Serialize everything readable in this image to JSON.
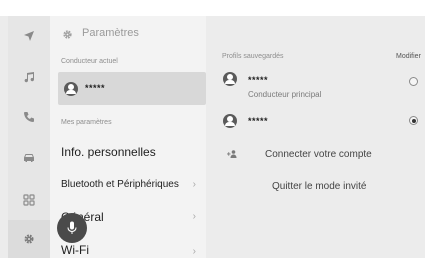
{
  "settings": {
    "title": "Paramètres",
    "current_driver_label": "Conducteur actuel",
    "current_driver_name": "*****",
    "my_settings_label": "Mes paramètres",
    "menu": [
      {
        "label": "Info. personnelles",
        "has_chevron": false
      },
      {
        "label": "Bluetooth et Périphériques",
        "has_chevron": true
      },
      {
        "label": "Général",
        "has_chevron": true
      },
      {
        "label": "Wi-Fi",
        "has_chevron": true
      }
    ]
  },
  "rail": {
    "icons": [
      "navigation-icon",
      "music-icon",
      "phone-icon",
      "car-icon",
      "apps-icon",
      "settings-gear-icon"
    ],
    "active": "settings-gear-icon"
  },
  "profiles": {
    "saved_label": "Profils sauvegardés",
    "edit_label": "Modifier",
    "items": [
      {
        "name": "*****",
        "subtitle": "Conducteur principal",
        "selected": false
      },
      {
        "name": "*****",
        "subtitle": "",
        "selected": true
      }
    ],
    "connect_account": "Connecter votre compte",
    "quit_guest": "Quitter le mode invité"
  },
  "colors": {
    "background": "#ececec",
    "sidebar": "#f3f3f3",
    "selected": "#d8d8d8",
    "voice_button": "#4a4a4a"
  }
}
